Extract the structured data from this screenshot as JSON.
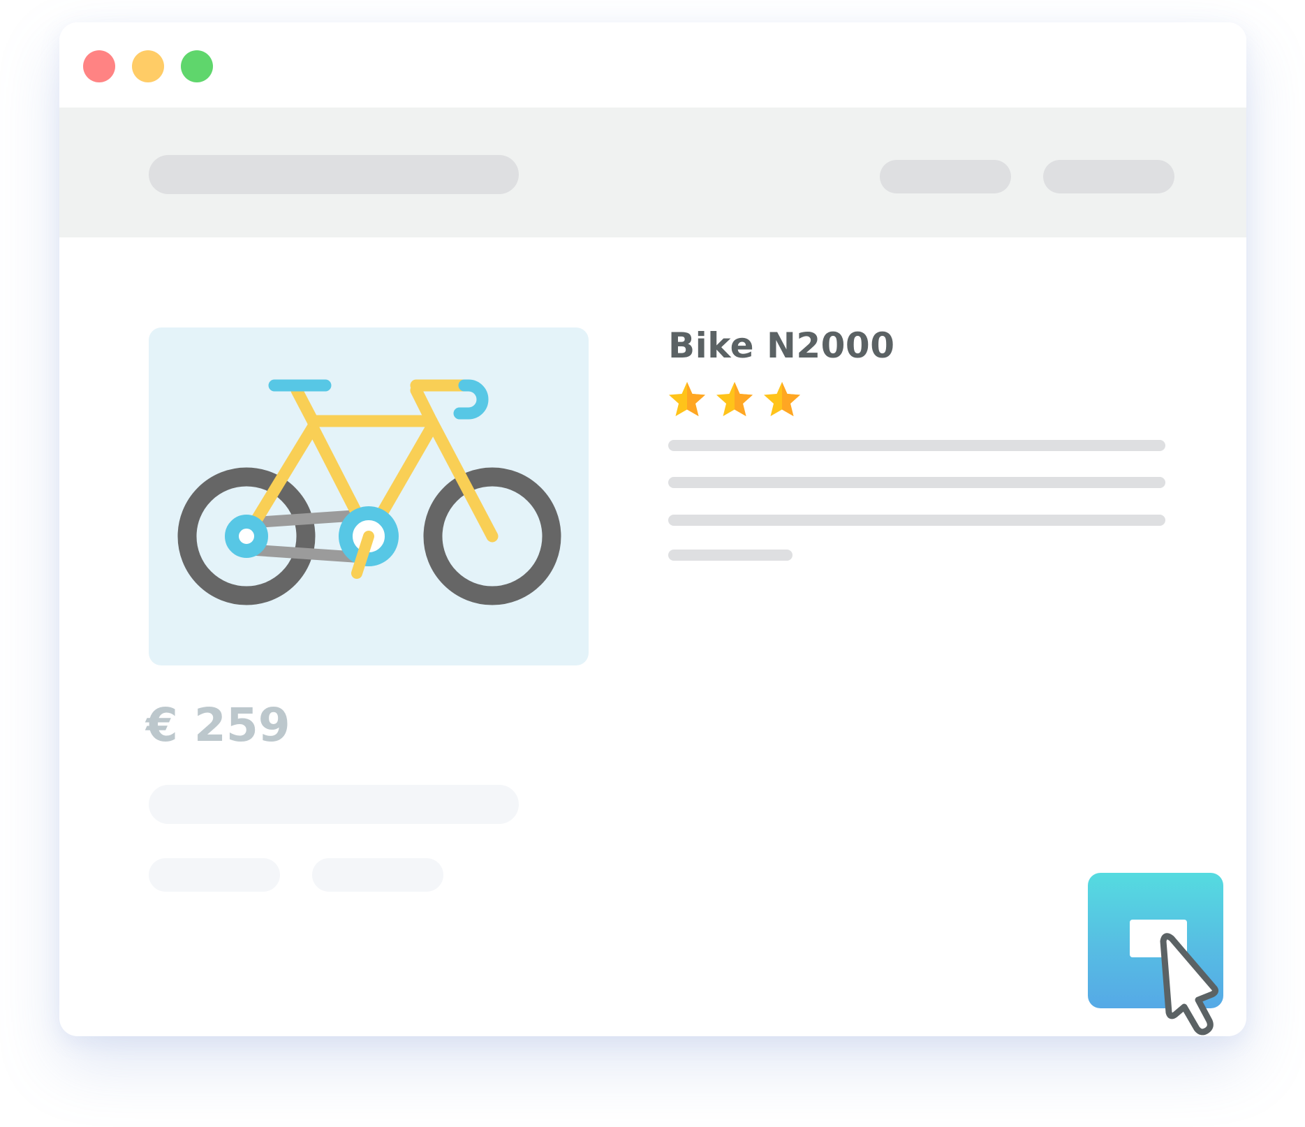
{
  "window": {
    "controls": [
      "close",
      "minimize",
      "maximize"
    ],
    "colors": {
      "close": "#ff8383",
      "minimize": "#ffcc66",
      "maximize": "#5fd66c"
    }
  },
  "navbar": {
    "search_placeholder": "",
    "links": [
      "",
      ""
    ]
  },
  "product": {
    "image_icon": "bicycle-icon",
    "title": "Bike N2000",
    "rating": 3,
    "rating_max": 3,
    "star_icon": "star-icon",
    "price": "€ 259",
    "description_lines": 4
  },
  "action": {
    "icon": "cursor-click-icon",
    "colors": {
      "top": "#55dbe0",
      "bottom": "#55a9e6"
    }
  },
  "colors": {
    "title": "#5b6264",
    "price": "#bcc7cc",
    "placeholder": "#dedfe1",
    "image_bg": "#e4f3f9",
    "bike_frame": "#f9cf55",
    "bike_wheel": "#666666",
    "bike_accent": "#57c7e5"
  }
}
